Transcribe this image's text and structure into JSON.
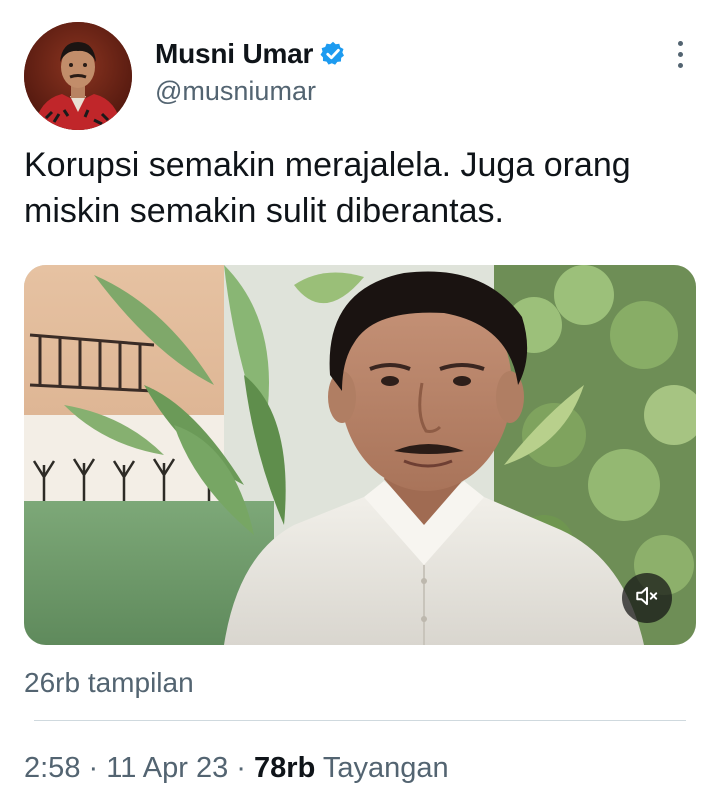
{
  "author": {
    "display_name": "Musni Umar",
    "handle": "@musniumar",
    "verified": true,
    "verified_color": "#1d9bf0"
  },
  "tweet": {
    "text": "Korupsi semakin merajalela. Juga orang miskin semakin sulit diberantas."
  },
  "media": {
    "type": "video",
    "muted": true,
    "mute_icon": "speaker-muted-icon"
  },
  "views_label": "26rb tampilan",
  "meta": {
    "time": "2:58",
    "sep1": " · ",
    "date": "11 Apr 23",
    "sep2": " · ",
    "count": "78rb",
    "count_label": " Tayangan"
  },
  "colors": {
    "text_primary": "#0f1419",
    "text_secondary": "#536471",
    "divider": "#cfd9de"
  }
}
